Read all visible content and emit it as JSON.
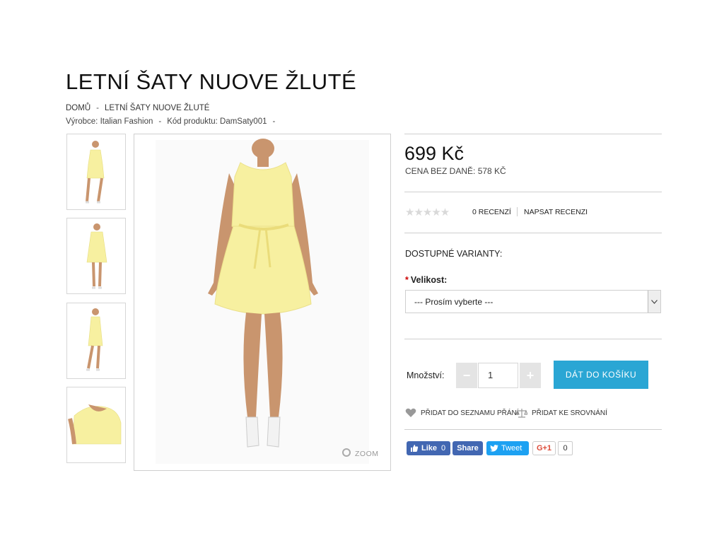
{
  "product": {
    "title": "LETNÍ ŠATY NUOVE ŽLUTÉ",
    "breadcrumb": [
      "DOMŮ",
      "LETNÍ ŠATY NUOVE ŽLUTÉ"
    ],
    "manufacturer": "Výrobce: Italian Fashion",
    "code": "Kód produktu: DamSaty001",
    "meta_trailing_sep": "-",
    "price": "699 Kč",
    "price_ex_tax": "CENA BEZ DANĚ: 578 KČ",
    "rating": 0,
    "stars": "★★★★★",
    "reviews_label": "0 RECENZÍ",
    "write_review_label": "NAPSAT RECENZI",
    "variants_label": "DOSTUPNÉ VARIANTY:",
    "size_label": "Velikost:",
    "size_required_mark": "*",
    "size_selected": "--- Prosím vyberte ---",
    "quantity_label": "Množství:",
    "quantity_value": "1",
    "minus_label": "−",
    "plus_label": "+",
    "add_to_cart_label": "DÁT DO KOŠÍKU",
    "wishlist_label": "PŘIDAT DO SEZNAMU PŘÁNÍ",
    "compare_label": "PŘIDAT KE SROVNÁNÍ",
    "zoom_label": "ZOOM",
    "dress_color": "#f7f0a0",
    "accent_color": "#2aa6d4"
  },
  "social": {
    "fb_like_label": "Like",
    "fb_like_count": "0",
    "fb_share_label": "Share",
    "tweet_label": "Tweet",
    "gplus_label": "G+1",
    "gplus_count": "0"
  }
}
